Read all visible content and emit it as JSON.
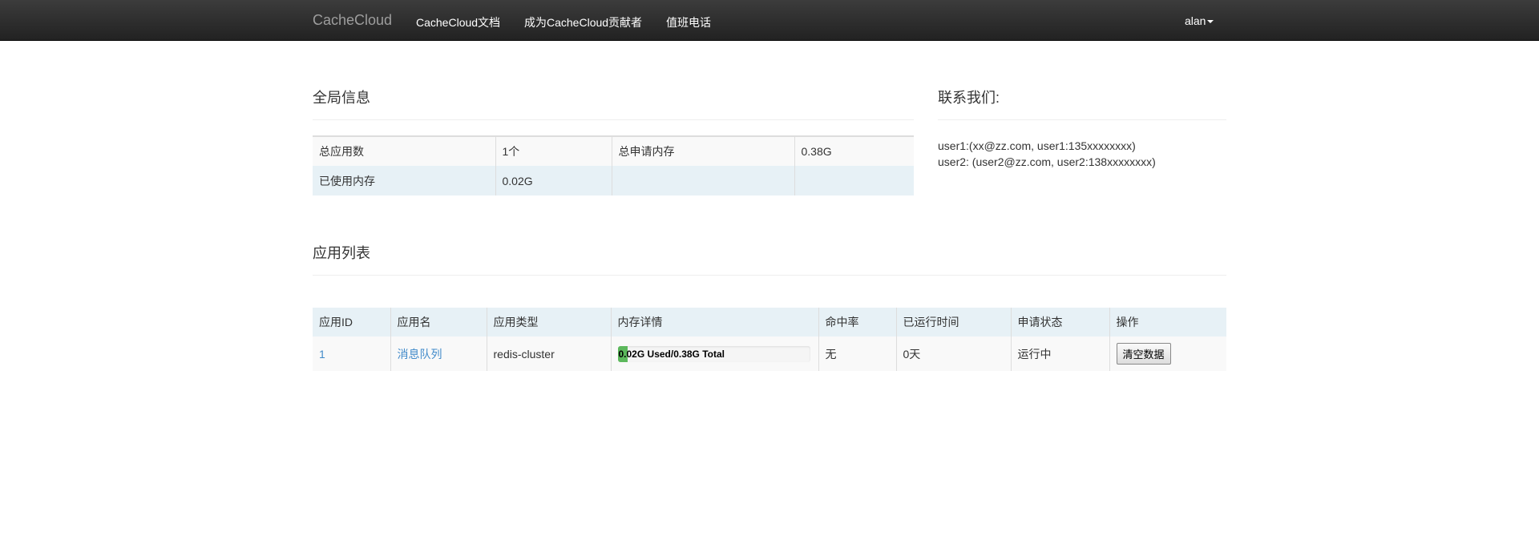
{
  "navbar": {
    "brand": "CacheCloud",
    "links": [
      "CacheCloud文档",
      "成为CacheCloud贡献者",
      "值班电话"
    ],
    "user": "alan"
  },
  "global_info": {
    "title": "全局信息",
    "rows": [
      [
        "总应用数",
        "1个",
        "总申请内存",
        "0.38G"
      ],
      [
        "已使用内存",
        "0.02G",
        "",
        ""
      ]
    ]
  },
  "contact": {
    "title": "联系我们:",
    "lines": [
      "user1:(xx@zz.com, user1:135xxxxxxxx)",
      "user2: (user2@zz.com, user2:138xxxxxxxx)"
    ]
  },
  "app_list": {
    "title": "应用列表",
    "headers": [
      "应用ID",
      "应用名",
      "应用类型",
      "内存详情",
      "命中率",
      "已运行时间",
      "申请状态",
      "操作"
    ],
    "rows": [
      {
        "id": "1",
        "name": "消息队列",
        "type": "redis-cluster",
        "memory_text": "0.02G  Used/0.38G  Total",
        "memory_used_fraction": 0.053,
        "hit_rate": "无",
        "uptime": "0天",
        "status": "运行中",
        "action": "清空数据"
      }
    ]
  },
  "colors": {
    "navbar_bg": "#222222",
    "link": "#428bca",
    "progress_fill": "#5cb85c",
    "table_info_row": "#e7f1f6"
  }
}
